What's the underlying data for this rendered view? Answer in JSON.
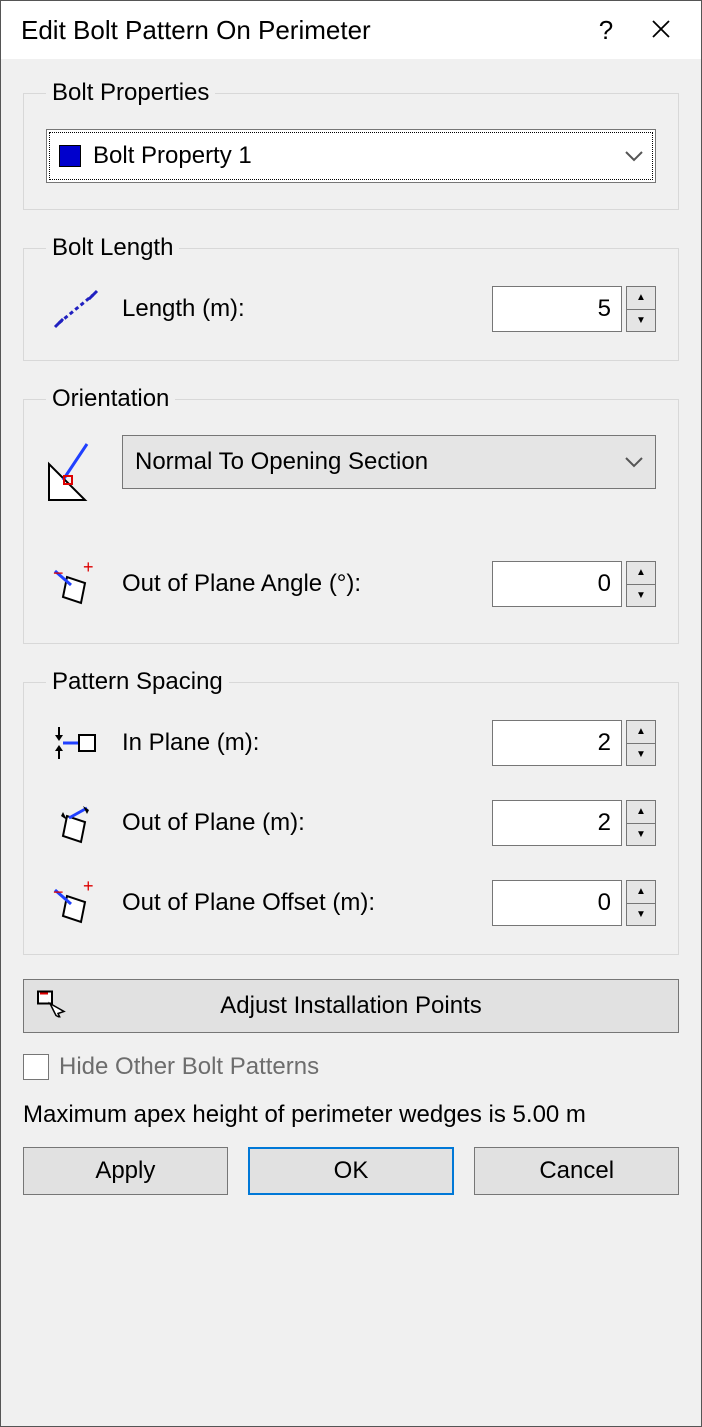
{
  "title": "Edit Bolt Pattern On Perimeter",
  "groups": {
    "properties": {
      "legend": "Bolt Properties",
      "selected": "Bolt Property 1"
    },
    "length": {
      "legend": "Bolt Length",
      "label": "Length (m):",
      "value": "5"
    },
    "orientation": {
      "legend": "Orientation",
      "selected": "Normal To Opening Section",
      "angle_label": "Out of Plane Angle (°):",
      "angle_value": "0"
    },
    "spacing": {
      "legend": "Pattern Spacing",
      "in_plane_label": "In Plane (m):",
      "in_plane_value": "2",
      "out_plane_label": "Out of Plane (m):",
      "out_plane_value": "2",
      "offset_label": "Out of Plane Offset (m):",
      "offset_value": "0"
    }
  },
  "adjust_label": "Adjust Installation Points",
  "hide_label": "Hide Other Bolt Patterns",
  "status": "Maximum apex height of perimeter wedges is 5.00 m",
  "buttons": {
    "apply": "Apply",
    "ok": "OK",
    "cancel": "Cancel"
  }
}
